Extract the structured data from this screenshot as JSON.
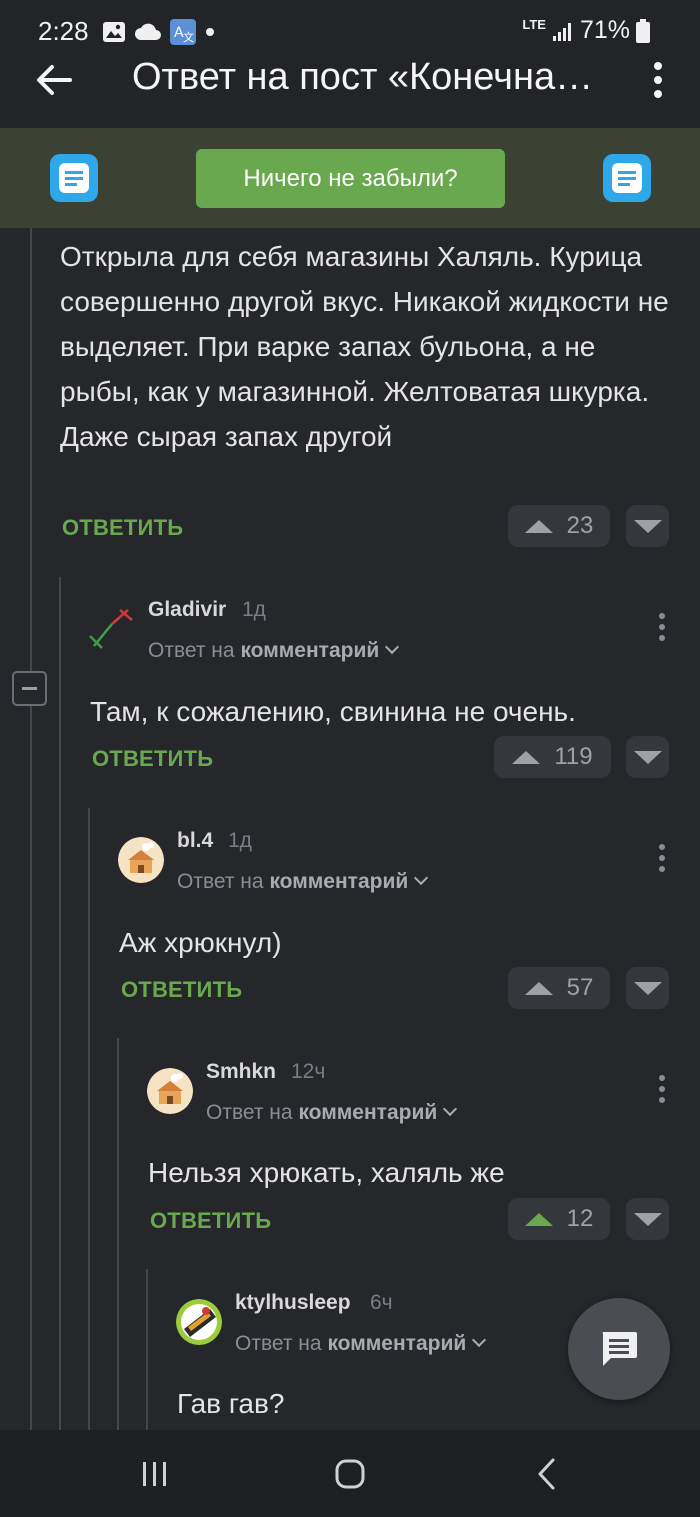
{
  "status": {
    "time": "2:28",
    "network": "LTE",
    "battery": "71%"
  },
  "app_bar": {
    "title": "Ответ на пост «Конечна…"
  },
  "banner": {
    "button_label": "Ничего не забыли?"
  },
  "comments": [
    {
      "text": "Открыла для себя магазины Халяль. Курица совершенно другой вкус. Никакой жидкости не выделяет. При варке запах бульона, а не рыбы, как у магазинной. Желтоватая шкурка. Даже сырая запах другой",
      "reply_label": "ОТВЕТИТЬ",
      "votes": "23"
    },
    {
      "username": "Gladivir",
      "time": "1д",
      "reply_prefix": "Ответ на",
      "reply_target": "комментарий",
      "text": "Там, к сожалению, свинина не очень.",
      "reply_label": "ОТВЕТИТЬ",
      "votes": "119"
    },
    {
      "username": "bl.4",
      "time": "1д",
      "reply_prefix": "Ответ на",
      "reply_target": "комментарий",
      "text": "Аж хрюкнул)",
      "reply_label": "ОТВЕТИТЬ",
      "votes": "57"
    },
    {
      "username": "Smhkn",
      "time": "12ч",
      "reply_prefix": "Ответ на",
      "reply_target": "комментарий",
      "text": "Нельзя хрюкать, халяль же",
      "reply_label": "ОТВЕТИТЬ",
      "votes": "12",
      "upvoted": true
    },
    {
      "username": "ktylhusleep",
      "time": "6ч",
      "reply_prefix": "Ответ на",
      "reply_target": "комментарий",
      "text": "Гав гав?"
    }
  ],
  "colors": {
    "accent_green": "#6aa84f",
    "background": "#25272a",
    "banner_bg": "#3b4234"
  }
}
